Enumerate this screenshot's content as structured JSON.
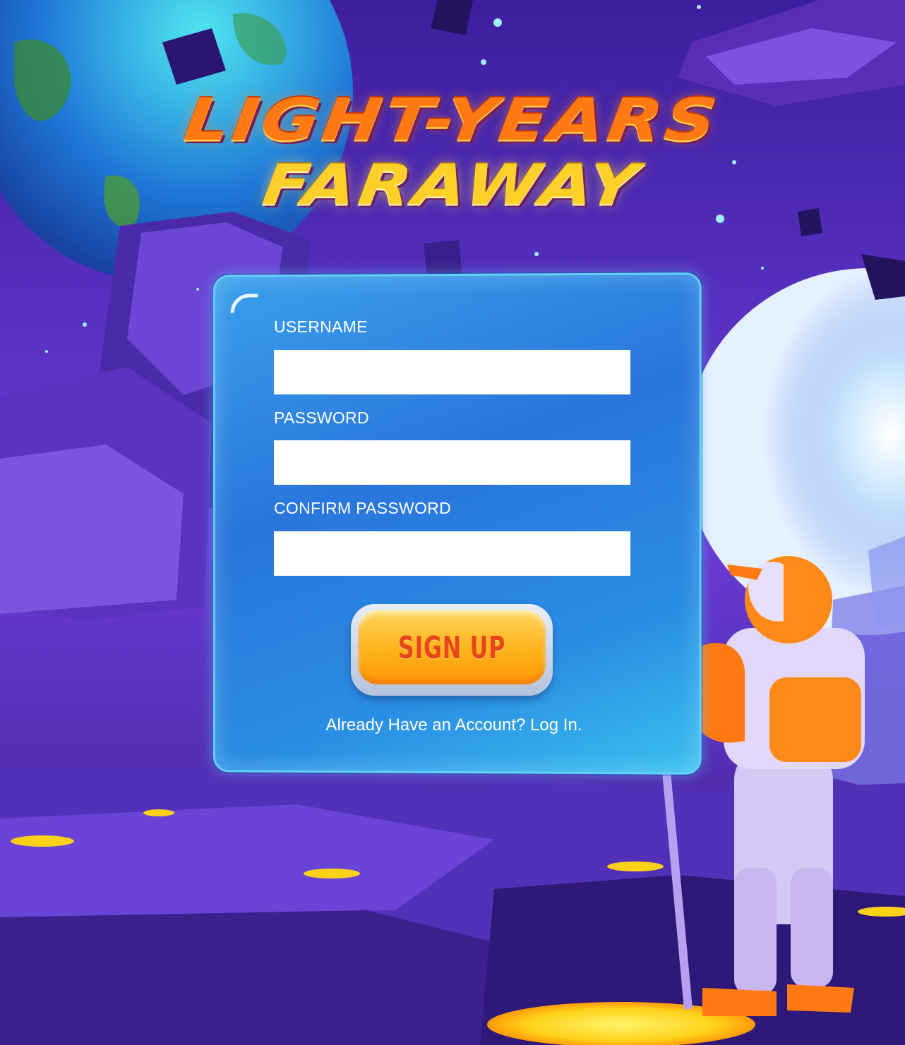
{
  "logo": {
    "line1": "LIGHT-YEARS",
    "line2": "FARAWAY"
  },
  "form": {
    "username_label": "USERNAME",
    "username_value": "",
    "password_label": "PASSWORD",
    "password_value": "",
    "confirm_label": "CONFIRM PASSWORD",
    "confirm_value": "",
    "signup_label": "SIGN UP",
    "login_link": "Already Have an Account? Log In."
  },
  "colors": {
    "sky": "#4a2fb8",
    "panel": "#2a7fdf",
    "panel_border": "#5fd2ff",
    "button": "#ffb21a",
    "button_text": "#e7461a",
    "logo_orange": "#ff7a12",
    "logo_yellow": "#ffd02a"
  }
}
